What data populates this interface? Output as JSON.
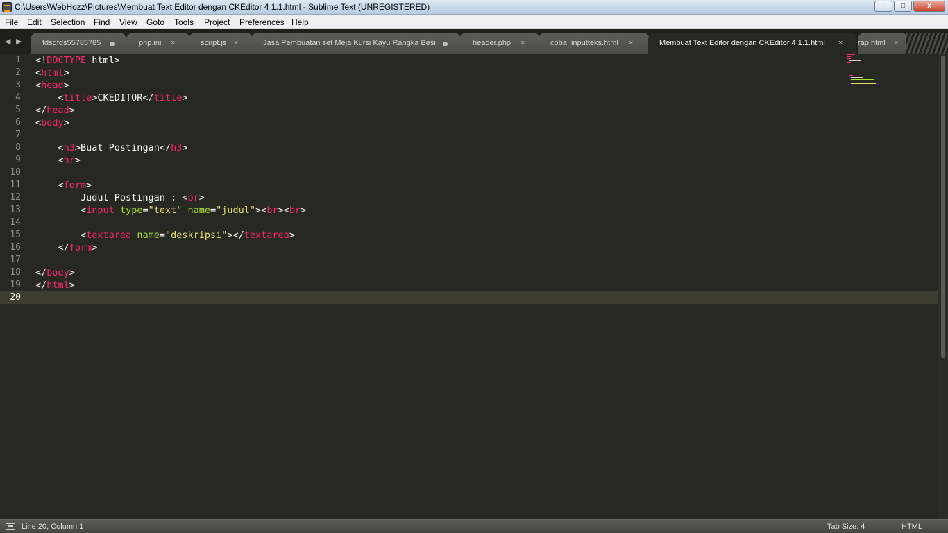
{
  "window": {
    "title": "C:\\Users\\WebHozz\\Pictures\\Membuat Text Editor dengan CKEditor 4 1.1.html - Sublime Text (UNREGISTERED)",
    "min_label": "–",
    "max_label": "□",
    "close_label": "x"
  },
  "menu": [
    "File",
    "Edit",
    "Selection",
    "Find",
    "View",
    "Goto",
    "Tools",
    "Project",
    "Preferences",
    "Help"
  ],
  "tabs": {
    "nav_prev": "◀",
    "nav_next": "▶",
    "items": [
      {
        "label": "fdsdfds55785785",
        "state": "modified",
        "marker": ""
      },
      {
        "label": "php.ini",
        "state": "saved",
        "marker": "×"
      },
      {
        "label": "script.js",
        "state": "saved",
        "marker": "×"
      },
      {
        "label": "Jasa Pembuatan set Meja Kursi Kayu Rangka Besi",
        "state": "modified",
        "marker": ""
      },
      {
        "label": "header.php",
        "state": "saved",
        "marker": "×"
      },
      {
        "label": "coba_inputteks.html",
        "state": "saved",
        "marker": "×"
      },
      {
        "label": "Membuat Text Editor dengan CKEditor 4 1.1.html",
        "state": "active",
        "marker": "×"
      },
      {
        "label": "rap.html",
        "state": "saved",
        "marker": "×"
      }
    ]
  },
  "editor": {
    "current_line": 20,
    "line_numbers": [
      "1",
      "2",
      "3",
      "4",
      "5",
      "6",
      "7",
      "8",
      "9",
      "10",
      "11",
      "12",
      "13",
      "14",
      "15",
      "16",
      "17",
      "18",
      "19",
      "20"
    ],
    "lines": [
      [
        {
          "t": "<!",
          "c": "plain"
        },
        {
          "t": "DOCTYPE",
          "c": "tag"
        },
        {
          "t": " html>",
          "c": "plain"
        }
      ],
      [
        {
          "t": "<",
          "c": "plain"
        },
        {
          "t": "html",
          "c": "tag"
        },
        {
          "t": ">",
          "c": "plain"
        }
      ],
      [
        {
          "t": "<",
          "c": "plain"
        },
        {
          "t": "head",
          "c": "tag"
        },
        {
          "t": ">",
          "c": "plain"
        }
      ],
      [
        {
          "t": "    <",
          "c": "plain"
        },
        {
          "t": "title",
          "c": "tag"
        },
        {
          "t": ">CKEDITOR</",
          "c": "plain"
        },
        {
          "t": "title",
          "c": "tag"
        },
        {
          "t": ">",
          "c": "plain"
        }
      ],
      [
        {
          "t": "</",
          "c": "plain"
        },
        {
          "t": "head",
          "c": "tag"
        },
        {
          "t": ">",
          "c": "plain"
        }
      ],
      [
        {
          "t": "<",
          "c": "plain"
        },
        {
          "t": "body",
          "c": "tag"
        },
        {
          "t": ">",
          "c": "plain"
        }
      ],
      [],
      [
        {
          "t": "    <",
          "c": "plain"
        },
        {
          "t": "h3",
          "c": "tag"
        },
        {
          "t": ">Buat Postingan</",
          "c": "plain"
        },
        {
          "t": "h3",
          "c": "tag"
        },
        {
          "t": ">",
          "c": "plain"
        }
      ],
      [
        {
          "t": "    <",
          "c": "plain"
        },
        {
          "t": "hr",
          "c": "tag"
        },
        {
          "t": ">",
          "c": "plain"
        }
      ],
      [],
      [
        {
          "t": "    <",
          "c": "plain"
        },
        {
          "t": "form",
          "c": "tag"
        },
        {
          "t": ">",
          "c": "plain"
        }
      ],
      [
        {
          "t": "        Judul Postingan : <",
          "c": "plain"
        },
        {
          "t": "br",
          "c": "tag"
        },
        {
          "t": ">",
          "c": "plain"
        }
      ],
      [
        {
          "t": "        <",
          "c": "plain"
        },
        {
          "t": "input",
          "c": "tag"
        },
        {
          "t": " ",
          "c": "plain"
        },
        {
          "t": "type",
          "c": "attr"
        },
        {
          "t": "=",
          "c": "plain"
        },
        {
          "t": "\"text\"",
          "c": "str"
        },
        {
          "t": " ",
          "c": "plain"
        },
        {
          "t": "name",
          "c": "attr"
        },
        {
          "t": "=",
          "c": "plain"
        },
        {
          "t": "\"judul\"",
          "c": "str"
        },
        {
          "t": "><",
          "c": "plain"
        },
        {
          "t": "br",
          "c": "tag"
        },
        {
          "t": "><",
          "c": "plain"
        },
        {
          "t": "br",
          "c": "tag"
        },
        {
          "t": ">",
          "c": "plain"
        }
      ],
      [],
      [
        {
          "t": "        <",
          "c": "plain"
        },
        {
          "t": "textarea",
          "c": "tag"
        },
        {
          "t": " ",
          "c": "plain"
        },
        {
          "t": "name",
          "c": "attr"
        },
        {
          "t": "=",
          "c": "plain"
        },
        {
          "t": "\"deskripsi\"",
          "c": "str"
        },
        {
          "t": "></",
          "c": "plain"
        },
        {
          "t": "textarea",
          "c": "tag"
        },
        {
          "t": ">",
          "c": "plain"
        }
      ],
      [
        {
          "t": "    </",
          "c": "plain"
        },
        {
          "t": "form",
          "c": "tag"
        },
        {
          "t": ">",
          "c": "plain"
        }
      ],
      [],
      [
        {
          "t": "</",
          "c": "plain"
        },
        {
          "t": "body",
          "c": "tag"
        },
        {
          "t": ">",
          "c": "plain"
        }
      ],
      [
        {
          "t": "</",
          "c": "plain"
        },
        {
          "t": "html",
          "c": "tag"
        },
        {
          "t": ">",
          "c": "plain"
        }
      ],
      []
    ]
  },
  "colors": {
    "background": "#272822",
    "tag": "#f92672",
    "attribute": "#a6e22e",
    "string": "#e6db74",
    "text": "#f8f8f2",
    "gutter": "#8f908a"
  },
  "status": {
    "position": "Line 20, Column 1",
    "tab_size": "Tab Size: 4",
    "syntax": "HTML"
  }
}
